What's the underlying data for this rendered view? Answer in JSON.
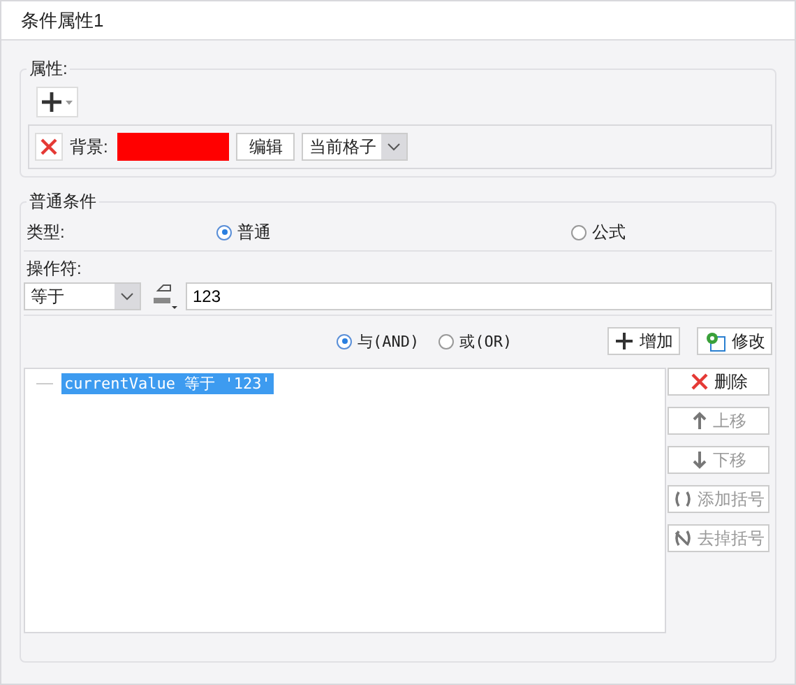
{
  "window": {
    "title": "条件属性1"
  },
  "properties": {
    "legend": "属性:",
    "row": {
      "label": "背景:",
      "color": "#ff0000",
      "edit_button": "编辑",
      "scope": "当前格子"
    }
  },
  "condition": {
    "legend": "普通条件",
    "type_label": "类型:",
    "types": [
      {
        "label": "普通",
        "selected": true
      },
      {
        "label": "公式",
        "selected": false
      }
    ],
    "operator_label": "操作符:",
    "operator": "等于",
    "value": "123",
    "joins": [
      {
        "label": "与(AND)",
        "selected": true
      },
      {
        "label": "或(OR)",
        "selected": false
      }
    ],
    "add_button": "增加",
    "modify_button": "修改",
    "list": [
      {
        "text": "currentValue 等于 '123'",
        "selected": true
      }
    ],
    "side_buttons": [
      {
        "kind": "delete",
        "label": "删除",
        "disabled": false
      },
      {
        "kind": "up",
        "label": "上移",
        "disabled": true
      },
      {
        "kind": "down",
        "label": "下移",
        "disabled": true
      },
      {
        "kind": "add-paren",
        "label": "添加括号",
        "disabled": true
      },
      {
        "kind": "remove-paren",
        "label": "去掉括号",
        "disabled": true
      }
    ]
  }
}
